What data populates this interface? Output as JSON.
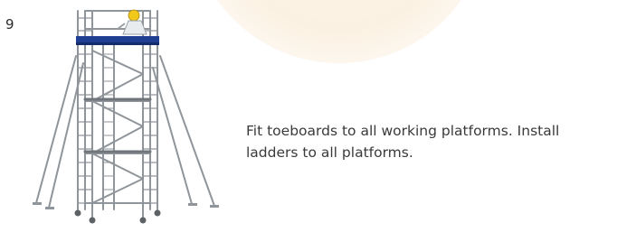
{
  "step": {
    "number": "9",
    "instruction": "Fit toeboards to all working platforms. Install\nladders to all platforms."
  },
  "colors": {
    "frame": "#8f959a",
    "platform": "#1f3f93",
    "worker_helmet": "#f2c81b",
    "watermark": "#fbf1e2"
  }
}
